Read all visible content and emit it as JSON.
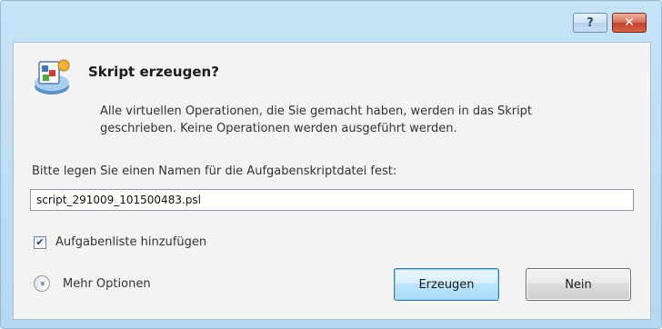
{
  "window": {
    "help_button": "?",
    "close_button": "✕"
  },
  "dialog": {
    "icon": "script-dialog-icon",
    "title": "Skript erzeugen?",
    "description": "Alle virtuellen Operationen, die Sie gemacht haben, werden in das Skript geschrieben. Keine Operationen werden ausgeführt werden.",
    "filename_prompt": "Bitte legen Sie einen Namen für die Aufgabenskriptdatei fest:",
    "filename_value": "script_291009_101500483.psl",
    "checkbox_label": "Aufgabenliste hinzufügen",
    "checkbox_checked": true,
    "checkmark": "✔",
    "more_options_icon": "double-chevron-down",
    "more_options_glyph": "»",
    "more_options_label": "Mehr Optionen",
    "primary_button": "Erzeugen",
    "secondary_button": "Nein"
  }
}
